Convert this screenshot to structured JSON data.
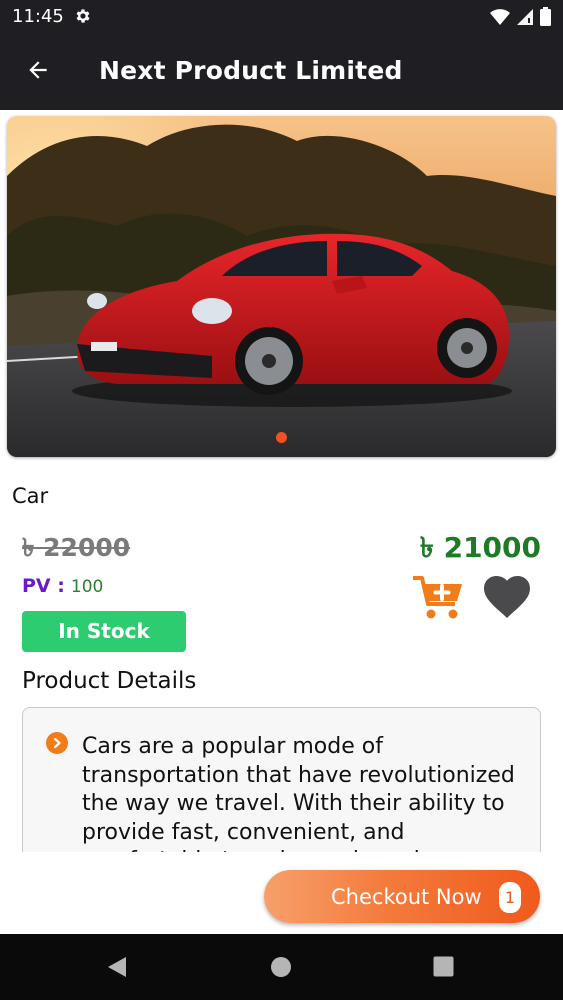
{
  "status_bar": {
    "time": "11:45",
    "icons": [
      "gear-icon",
      "wifi-icon",
      "signal-icon",
      "battery-icon"
    ]
  },
  "app_bar": {
    "title": "Next Product Limited",
    "back_icon": "arrow-left-icon"
  },
  "hero": {
    "image": "red sports car on road at sunset",
    "carousel_indicator_color": "#f4511e"
  },
  "product": {
    "name": "Car",
    "old_price": "৳ 22000",
    "new_price": "৳ 21000",
    "pv_label": "PV :",
    "pv_value": "100",
    "stock_status": "In Stock",
    "cart_icon": "add-to-cart-icon",
    "favorite_icon": "heart-icon"
  },
  "details": {
    "heading": "Product Details",
    "text": "Cars are a popular mode of transportation that have revolutionized the way we travel. With their ability to provide fast, convenient, and comfortable travel, cars have become"
  },
  "checkout": {
    "label": "Checkout Now",
    "count": "1"
  },
  "colors": {
    "app_bar": "#1f1f23",
    "accent": "#f47a3c",
    "price_green": "#1e7a25",
    "stock_green": "#2ecc71",
    "pv_purple": "#6a1bc4"
  },
  "nav": {
    "icons": [
      "back-triangle-icon",
      "home-circle-icon",
      "recents-square-icon"
    ]
  }
}
